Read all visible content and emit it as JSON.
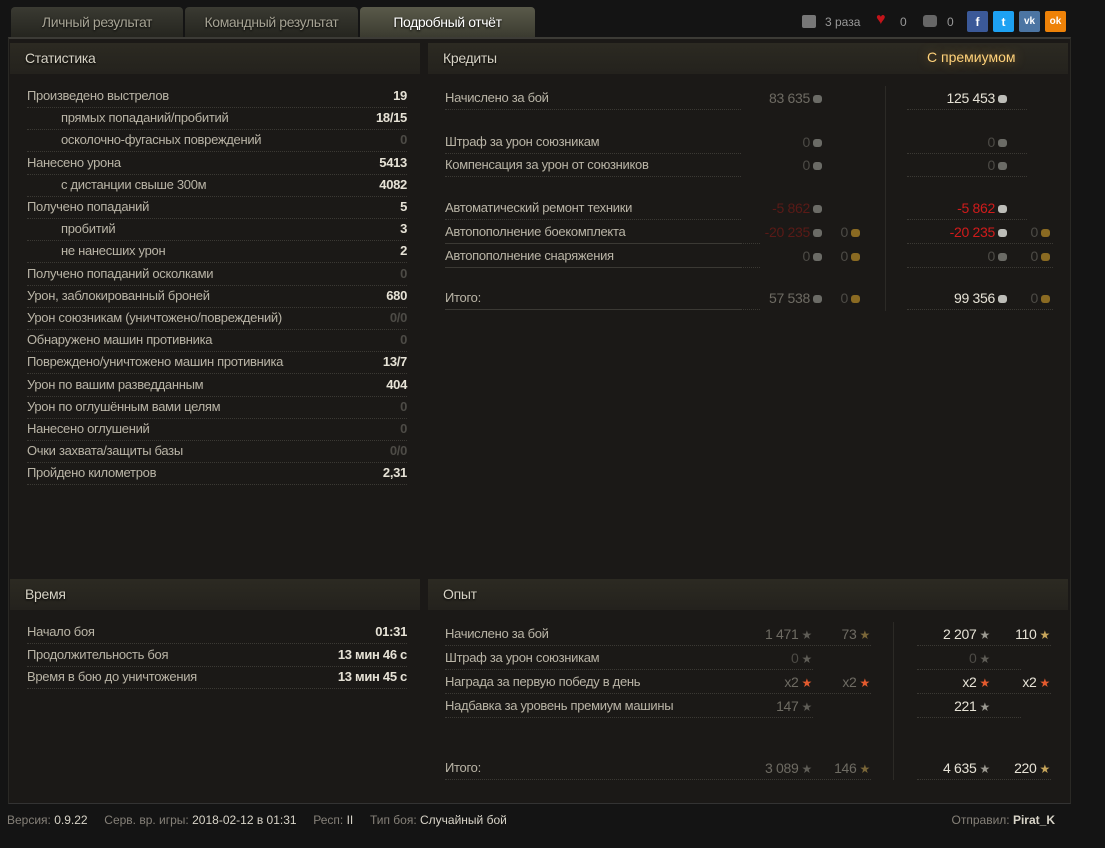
{
  "tabs": [
    {
      "label": "Личный результат"
    },
    {
      "label": "Командный результат"
    },
    {
      "label": "Подробный отчёт"
    }
  ],
  "social": {
    "downloads": "3 раза",
    "likes": "0",
    "comments": "0",
    "fb": "f",
    "tw": "t",
    "vk": "vk",
    "ok": "ok"
  },
  "stats": {
    "title": "Статистика",
    "rows": [
      {
        "label": "Произведено выстрелов",
        "value": "19",
        "indent": false,
        "style": "bright"
      },
      {
        "label": "прямых попаданий/пробитий",
        "value": "18/15",
        "indent": true,
        "style": "bright"
      },
      {
        "label": "осколочно-фугасных повреждений",
        "value": "0",
        "indent": true,
        "style": "dim"
      },
      {
        "label": "Нанесено урона",
        "value": "5413",
        "indent": false,
        "style": "bright"
      },
      {
        "label": "с дистанции свыше 300м",
        "value": "4082",
        "indent": true,
        "style": "bright"
      },
      {
        "label": "Получено попаданий",
        "value": "5",
        "indent": false,
        "style": "bright"
      },
      {
        "label": "пробитий",
        "value": "3",
        "indent": true,
        "style": "bright"
      },
      {
        "label": "не нанесших урон",
        "value": "2",
        "indent": true,
        "style": "bright"
      },
      {
        "label": "Получено попаданий осколками",
        "value": "0",
        "indent": false,
        "style": "dim"
      },
      {
        "label": "Урон, заблокированный броней",
        "value": "680",
        "indent": false,
        "style": "bright"
      },
      {
        "label": "Урон союзникам (уничтожено/повреждений)",
        "value": "0/0",
        "indent": false,
        "style": "dim"
      },
      {
        "label": "Обнаружено машин противника",
        "value": "0",
        "indent": false,
        "style": "dim"
      },
      {
        "label": "Повреждено/уничтожено машин противника",
        "value": "13/7",
        "indent": false,
        "style": "bright"
      },
      {
        "label": "Урон по вашим разведданным",
        "value": "404",
        "indent": false,
        "style": "bright"
      },
      {
        "label": "Урон по оглушённым вами целям",
        "value": "0",
        "indent": false,
        "style": "dim"
      },
      {
        "label": "Нанесено оглушений",
        "value": "0",
        "indent": false,
        "style": "dim"
      },
      {
        "label": "Очки захвата/защиты базы",
        "value": "0/0",
        "indent": false,
        "style": "dim"
      },
      {
        "label": "Пройдено километров",
        "value": "2,31",
        "indent": false,
        "style": "bright"
      }
    ]
  },
  "credits": {
    "title": "Кредиты",
    "premium_label": "С премиумом",
    "rows": [
      {
        "label": "Начислено за бой",
        "c1": "83 635",
        "c1s": "mid",
        "c2": null,
        "c3": "125 453",
        "c3s": "bright",
        "c4": null
      },
      {
        "label": "Штраф за урон союзникам",
        "c1": "0",
        "c1s": "dim",
        "c2": null,
        "c3": "0",
        "c3s": "dim",
        "c4": null
      },
      {
        "label": "Компенсация за урон от союзников",
        "c1": "0",
        "c1s": "dim",
        "c2": null,
        "c3": "0",
        "c3s": "dim",
        "c4": null
      },
      {
        "label": "Автоматический ремонт техники",
        "c1": "-5 862",
        "c1s": "dred",
        "c2": null,
        "c3": "-5 862",
        "c3s": "red",
        "c4": null
      },
      {
        "label": "Автопополнение боекомплекта",
        "c1": "-20 235",
        "c1s": "dred",
        "c2": "0",
        "c3": "-20 235",
        "c3s": "red",
        "c4": "0"
      },
      {
        "label": "Автопополнение снаряжения",
        "c1": "0",
        "c1s": "dim",
        "c2": "0",
        "c3": "0",
        "c3s": "dim",
        "c4": "0"
      },
      {
        "label": "Итого:",
        "c1": "57 538",
        "c1s": "mid",
        "c2": "0",
        "c3": "99 356",
        "c3s": "bright",
        "c4": "0"
      }
    ]
  },
  "time": {
    "title": "Время",
    "rows": [
      {
        "label": "Начало боя",
        "value": "01:31"
      },
      {
        "label": "Продолжительность боя",
        "value": "13 мин 46 с"
      },
      {
        "label": "Время в бою до уничтожения",
        "value": "13 мин 45 с"
      }
    ]
  },
  "exp": {
    "title": "Опыт",
    "rows": [
      {
        "label": "Начисленo за бой",
        "c1": "1 471",
        "c2": "73",
        "c3": "2 207",
        "c4": "110",
        "special": false
      },
      {
        "label": "Штраф за урон союзникам",
        "c1": "0",
        "c2": null,
        "c3": "0",
        "c4": null,
        "special": false
      },
      {
        "label": "Награда за первую победу в день",
        "c1": "x2",
        "c2": "x2",
        "c3": "x2",
        "c4": "x2",
        "special": true
      },
      {
        "label": "Надбавка за уровень премиум машины",
        "c1": "147",
        "c2": null,
        "c3": "221",
        "c4": null,
        "special": false
      },
      {
        "label": "Итого:",
        "c1": "3 089",
        "c2": "146",
        "c3": "4 635",
        "c4": "220",
        "special": false
      }
    ]
  },
  "footer": {
    "version_label": "Версия:",
    "version": "0.9.22",
    "server_time_label": "Серв. вр. игры:",
    "server_time": "2018-02-12 в 01:31",
    "region_label": "Респ:",
    "region": "II",
    "battle_type_label": "Тип боя:",
    "battle_type": "Случайный бой",
    "sender_label": "Отправил:",
    "sender": "Pirat_K"
  },
  "colors": {
    "accent": "#ffd27a",
    "red": "#d11b1b",
    "fb": "#3b5998",
    "tw": "#1da1f2",
    "vk": "#4c75a3",
    "ok": "#ee8208"
  }
}
